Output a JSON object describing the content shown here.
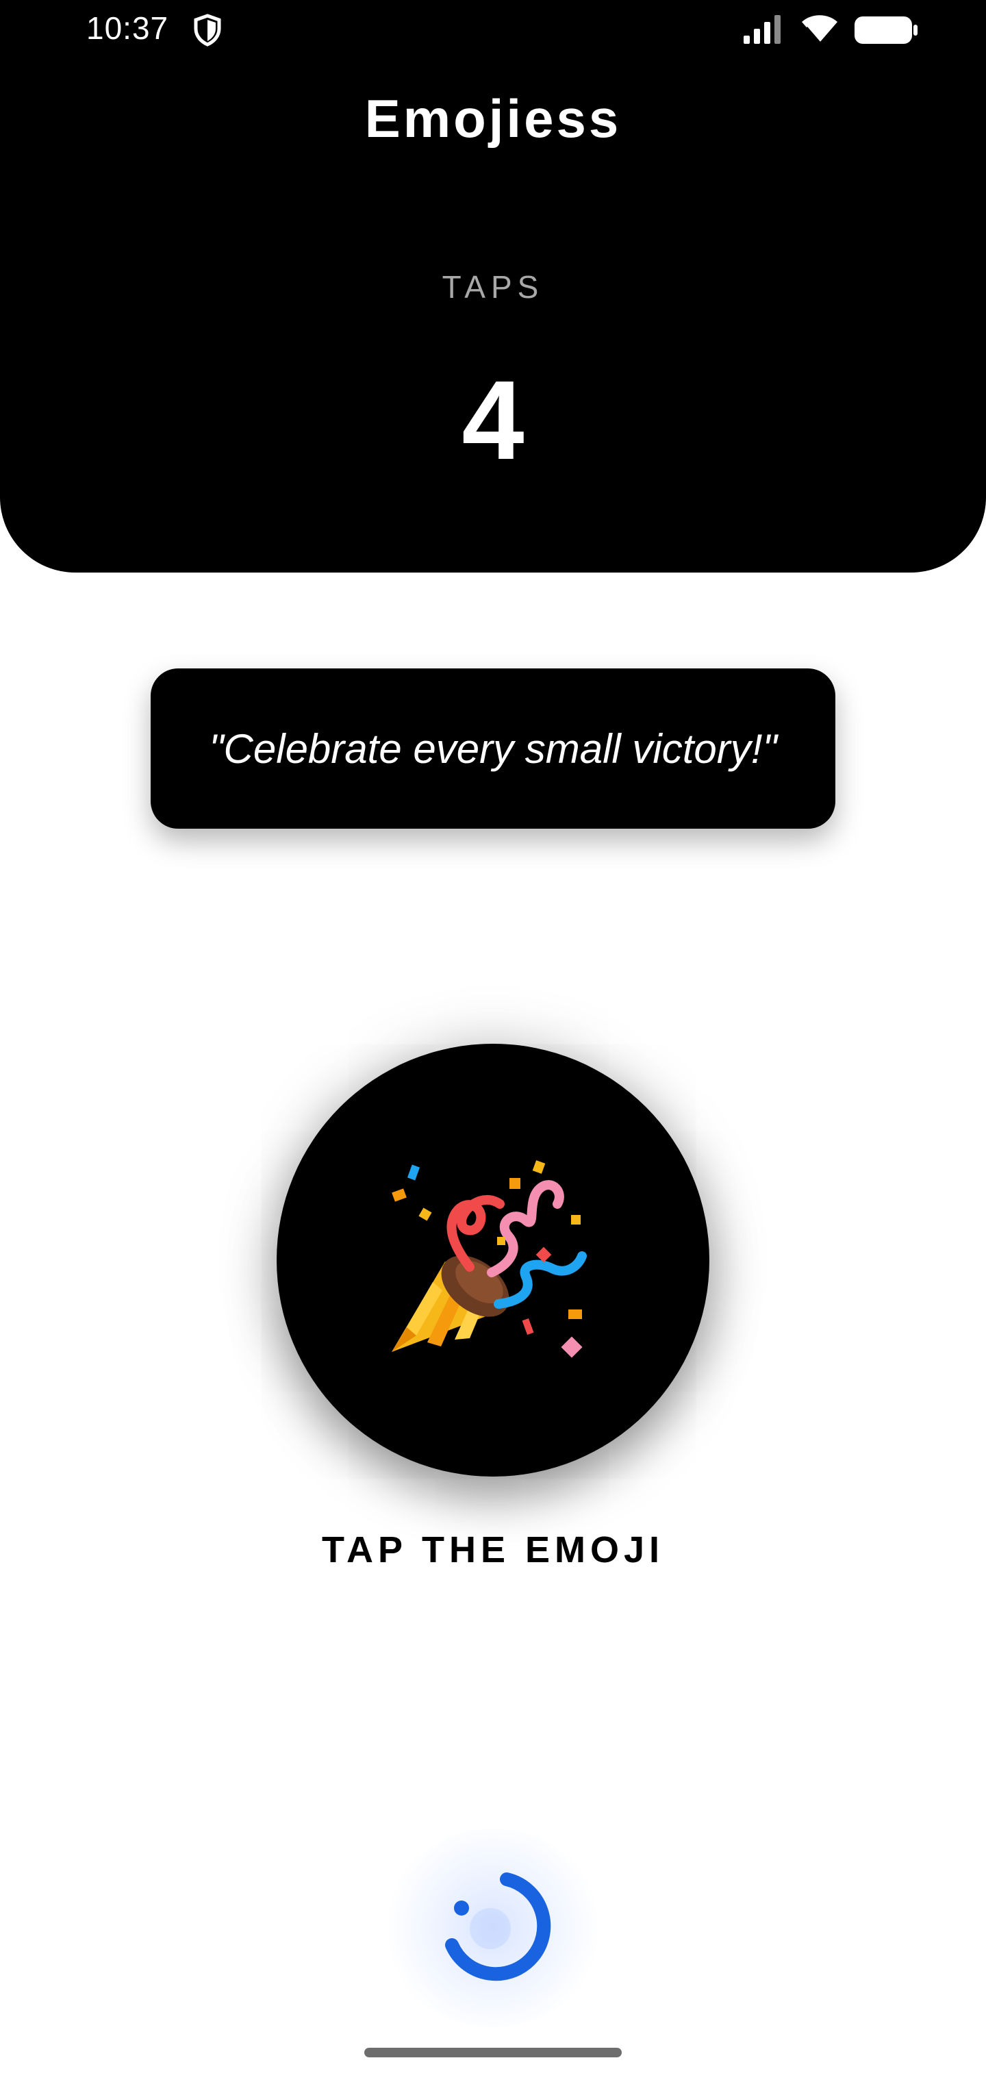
{
  "status_bar": {
    "time": "10:37",
    "icons": [
      "shield-icon",
      "signal-icon",
      "wifi-icon",
      "battery-icon"
    ]
  },
  "header": {
    "title": "Emojiess",
    "taps_label": "TAPS",
    "taps_count": "4"
  },
  "quote": {
    "text": "\"Celebrate every small victory!\""
  },
  "emoji": {
    "icon": "party-popper-icon"
  },
  "hint": {
    "text": "TAP THE EMOJI"
  },
  "loader": {
    "icon": "loading-spinner-icon"
  },
  "colors": {
    "header_bg": "#000000",
    "page_bg": "#ffffff",
    "accent_blue": "#1a63e0",
    "label_gray": "#a8a8a8"
  }
}
